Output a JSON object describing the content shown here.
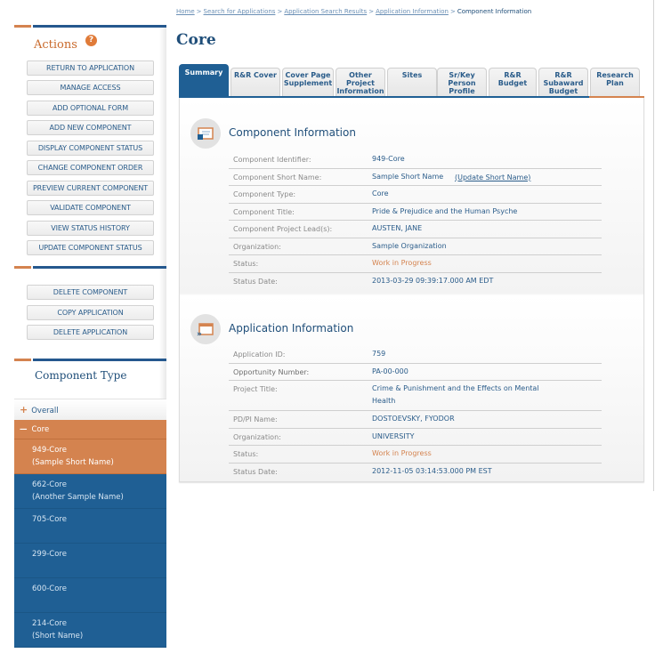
{
  "breadcrumb": {
    "items": [
      "Home",
      "Search for Applications",
      "Application Search Results",
      "Application Information"
    ],
    "current": "Component Information",
    "separator": ">"
  },
  "page": {
    "title": "Core"
  },
  "sidebar": {
    "actions_title": "Actions",
    "help_icon": "?",
    "actions": [
      "RETURN TO APPLICATION",
      "MANAGE ACCESS",
      "ADD OPTIONAL FORM",
      "ADD NEW COMPONENT",
      "DISPLAY COMPONENT STATUS",
      "CHANGE COMPONENT ORDER",
      "PREVIEW CURRENT COMPONENT",
      "VALIDATE COMPONENT",
      "VIEW STATUS HISTORY",
      "UPDATE COMPONENT STATUS"
    ],
    "secondary_actions": [
      "DELETE COMPONENT",
      "COPY APPLICATION",
      "DELETE APPLICATION"
    ],
    "component_type_title": "Component Type",
    "tree": {
      "overall": {
        "symbol": "+",
        "label": "Overall"
      },
      "core": {
        "symbol": "—",
        "label": "Core"
      }
    },
    "components": [
      {
        "id": "949-Core",
        "name": "(Sample Short Name)",
        "active": true
      },
      {
        "id": "662-Core",
        "name": "(Another Sample Name)",
        "active": false
      },
      {
        "id": "705-Core",
        "name": "",
        "active": false
      },
      {
        "id": "299-Core",
        "name": "",
        "active": false
      },
      {
        "id": "600-Core",
        "name": "",
        "active": false
      },
      {
        "id": "214-Core",
        "name": "(Short Name)",
        "active": false
      }
    ]
  },
  "tabs": [
    {
      "label": "Summary",
      "active": true
    },
    {
      "label": "R&R Cover"
    },
    {
      "label": "Cover Page Supplement"
    },
    {
      "label": "Other Project Information"
    },
    {
      "label": "Sites"
    },
    {
      "label": "Sr/Key Person Profile"
    },
    {
      "label": "R&R Budget"
    },
    {
      "label": "R&R Subaward Budget"
    },
    {
      "label": "Research Plan"
    }
  ],
  "component_info": {
    "title": "Component Information",
    "rows": [
      {
        "label": "Component Identifier:",
        "value": "949-Core"
      },
      {
        "label": "Component Short Name:",
        "value": "Sample Short Name",
        "link": "(Update Short Name)"
      },
      {
        "label": "Component Type:",
        "value": "Core"
      },
      {
        "label": "Component Title:",
        "value": "Pride & Prejudice and the Human Psyche"
      },
      {
        "label": "Component Project Lead(s):",
        "value": "AUSTEN, JANE"
      },
      {
        "label": "Organization:",
        "value": "Sample Organization"
      },
      {
        "label": "Status:",
        "value": "Work in Progress",
        "status": true
      },
      {
        "label": "Status Date:",
        "value": "2013-03-29 09:39:17.000 AM EDT"
      }
    ]
  },
  "application_info": {
    "title": "Application Information",
    "rows": [
      {
        "label": "Application ID:",
        "value": "759"
      },
      {
        "label": "Opportunity Number:",
        "value": "PA-00-000"
      },
      {
        "label": "Project Title:",
        "value": "Crime & Punishment and the Effects on Mental Health"
      },
      {
        "label": "PD/PI Name:",
        "value": "DOSTOEVSKY, FYODOR"
      },
      {
        "label": "Organization:",
        "value": "UNIVERSITY"
      },
      {
        "label": "Status:",
        "value": "Work in Progress",
        "status": true
      },
      {
        "label": "Status Date:",
        "value": "2012-11-05 03:14:53.000 PM EST"
      }
    ]
  },
  "colors": {
    "brand_blue": "#1f5f94",
    "accent_orange": "#d4834f",
    "text_blue": "#2a5c8a",
    "label_gray": "#8a8a8a"
  }
}
